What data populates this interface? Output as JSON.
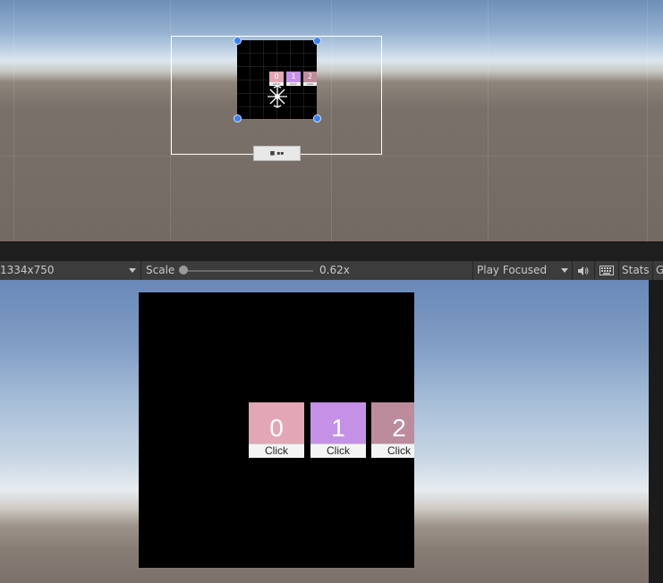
{
  "toolbar": {
    "resolution": "1334x750",
    "scale_label": "Scale",
    "scale_value": "0.62x",
    "play_mode": "Play Focused",
    "stats_label": "Stats",
    "gizmos_label": "G"
  },
  "scene_strip_text": "■ ▪▪",
  "tiles": [
    {
      "number": "0",
      "button": "Click",
      "color": "#e3a6b4"
    },
    {
      "number": "1",
      "button": "Click",
      "color": "#c591e6"
    },
    {
      "number": "2",
      "button": "Click",
      "color": "#bd8c9c"
    }
  ],
  "icons": {
    "resolution_dropdown": "chevron-down-icon",
    "play_mode_dropdown": "chevron-down-icon",
    "audio": "speaker-icon",
    "keyboard": "keyboard-icon",
    "pivot": "transform-pivot-icon"
  },
  "colors": {
    "panel": "#000000",
    "handle": "#3b82f6",
    "toolbar_bg": "#3c3c3c",
    "toolbar_text": "#c8c8c8"
  }
}
